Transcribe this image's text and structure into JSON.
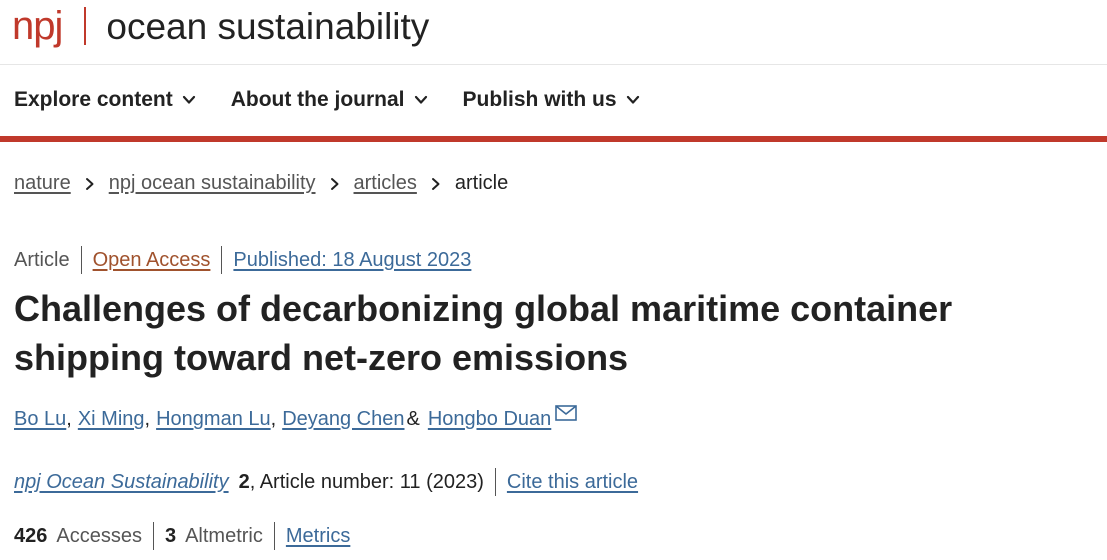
{
  "brand": {
    "prefix": "npj",
    "journal": "ocean sustainability",
    "colors": {
      "accent": "#c0392b",
      "link": "#3c6a99",
      "open_access": "#a0522d"
    }
  },
  "nav": {
    "items": [
      {
        "label": "Explore content",
        "icon": "chevron-down-icon"
      },
      {
        "label": "About the journal",
        "icon": "chevron-down-icon"
      },
      {
        "label": "Publish with us",
        "icon": "chevron-down-icon"
      }
    ]
  },
  "breadcrumb": {
    "items": [
      "nature",
      "npj ocean sustainability",
      "articles"
    ],
    "current": "article",
    "separator_icon": "chevron-right-icon"
  },
  "article": {
    "type": "Article",
    "access": "Open Access",
    "published": "Published: 18 August 2023",
    "title": "Challenges of decarbonizing global maritime container shipping toward net-zero emissions",
    "authors": [
      "Bo Lu",
      "Xi Ming",
      "Hongman Lu",
      "Deyang Chen",
      "Hongbo Duan"
    ],
    "author_separator": ",",
    "author_last_separator": "&",
    "corresponding_icon": "mail-icon",
    "journal": "npj Ocean Sustainability",
    "volume": "2",
    "article_number": ", Article number: 11 (2023)",
    "cite_label": "Cite this article",
    "metrics": {
      "accesses_count": "426",
      "accesses_label": "Accesses",
      "altmetric_count": "3",
      "altmetric_label": "Altmetric",
      "metrics_link": "Metrics"
    }
  }
}
